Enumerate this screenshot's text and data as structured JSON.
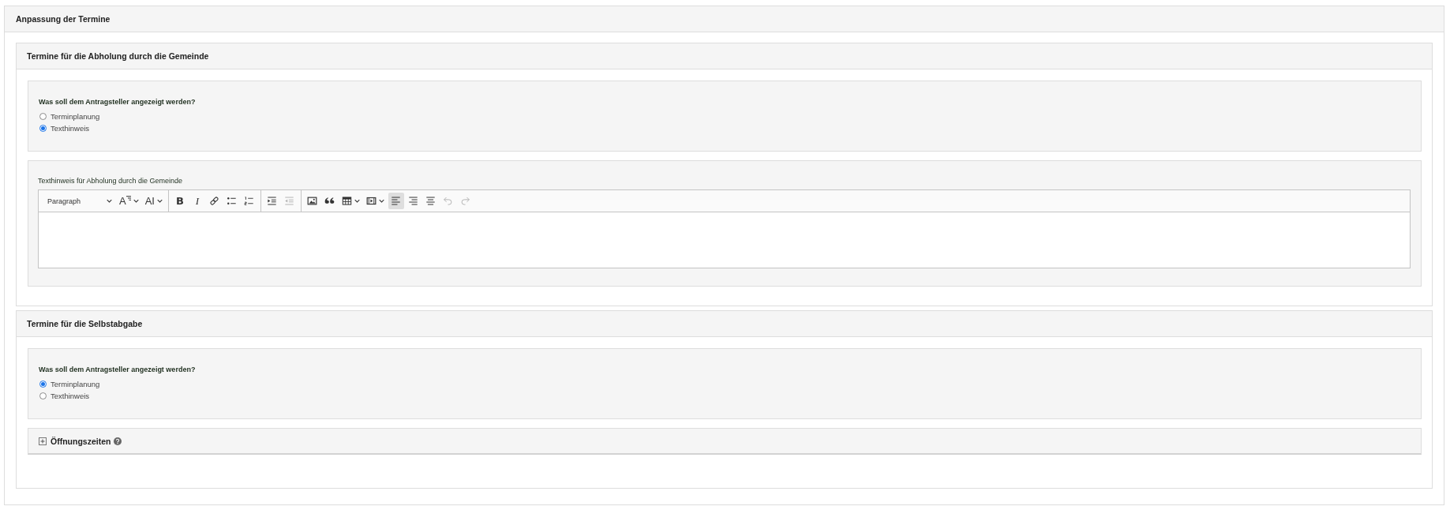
{
  "panel": {
    "title": "Anpassung der Termine",
    "sections": [
      {
        "title": "Termine für die Abholung durch die Gemeinde",
        "question": {
          "label": "Was soll dem Antragsteller angezeigt werden?",
          "options": [
            {
              "label": "Terminplanung",
              "selected": false
            },
            {
              "label": "Texthinweis",
              "selected": true
            }
          ]
        },
        "editor": {
          "label": "Texthinweis für Abholung durch die Gemeinde",
          "toolbar": {
            "groups": [
              {
                "items": [
                  {
                    "kind": "heading",
                    "text": "Paragraph",
                    "dropdown": true,
                    "disabled": false,
                    "on": false
                  },
                  {
                    "kind": "font-size",
                    "text": "A",
                    "dropdown": true,
                    "disabled": false,
                    "on": false
                  },
                  {
                    "kind": "font-family",
                    "text": "AI",
                    "dropdown": true,
                    "disabled": false,
                    "on": false
                  }
                ]
              },
              {
                "items": [
                  {
                    "kind": "bold",
                    "text": "B",
                    "dropdown": false,
                    "disabled": false,
                    "on": false
                  },
                  {
                    "kind": "italic",
                    "text": "I",
                    "dropdown": false,
                    "disabled": false,
                    "on": false
                  },
                  {
                    "kind": "link",
                    "dropdown": false,
                    "disabled": false,
                    "on": false
                  },
                  {
                    "kind": "bulleted-list",
                    "dropdown": false,
                    "disabled": false,
                    "on": false
                  },
                  {
                    "kind": "numbered-list",
                    "dropdown": false,
                    "disabled": false,
                    "on": false
                  }
                ]
              },
              {
                "items": [
                  {
                    "kind": "indent",
                    "dropdown": false,
                    "disabled": false,
                    "on": false
                  },
                  {
                    "kind": "outdent",
                    "dropdown": false,
                    "disabled": true,
                    "on": false
                  }
                ]
              },
              {
                "items": [
                  {
                    "kind": "image",
                    "dropdown": false,
                    "disabled": false,
                    "on": false
                  },
                  {
                    "kind": "quote",
                    "dropdown": false,
                    "disabled": false,
                    "on": false
                  },
                  {
                    "kind": "table",
                    "dropdown": true,
                    "disabled": false,
                    "on": false
                  },
                  {
                    "kind": "media",
                    "dropdown": true,
                    "disabled": false,
                    "on": false
                  },
                  {
                    "kind": "align-left",
                    "dropdown": false,
                    "disabled": false,
                    "on": true
                  },
                  {
                    "kind": "align-right",
                    "dropdown": false,
                    "disabled": false,
                    "on": false
                  },
                  {
                    "kind": "align-center",
                    "dropdown": false,
                    "disabled": false,
                    "on": false
                  },
                  {
                    "kind": "undo",
                    "dropdown": false,
                    "disabled": true,
                    "on": false
                  },
                  {
                    "kind": "redo",
                    "dropdown": false,
                    "disabled": true,
                    "on": false
                  }
                ]
              }
            ]
          }
        }
      },
      {
        "title": "Termine für die Selbstabgabe",
        "question": {
          "label": "Was soll dem Antragsteller angezeigt werden?",
          "options": [
            {
              "label": "Terminplanung",
              "selected": true
            },
            {
              "label": "Texthinweis",
              "selected": false
            }
          ]
        },
        "collapsible": {
          "title": "Öffnungszeiten",
          "expanded": false
        }
      }
    ]
  }
}
